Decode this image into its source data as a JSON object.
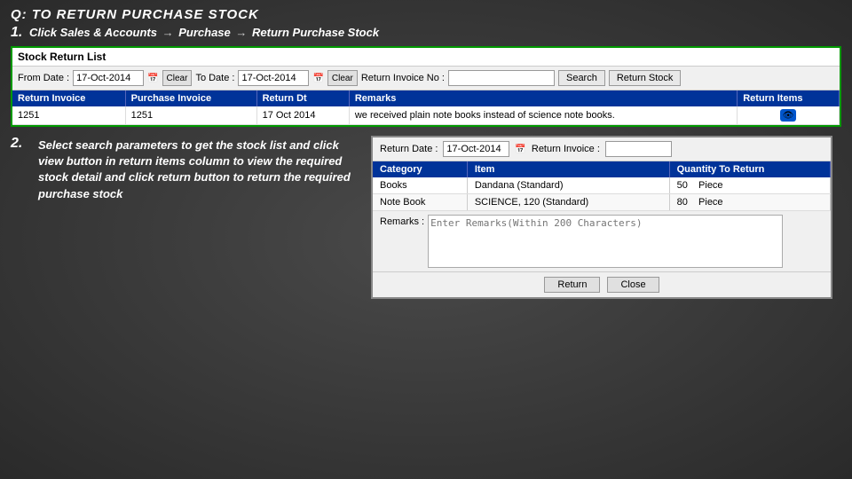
{
  "title": "Q: TO RETURN PURCHASE STOCK",
  "step1": {
    "num": "1.",
    "text": "Click Sales & Accounts",
    "arrow1": "→",
    "part2": "Purchase",
    "arrow2": "→",
    "part3": "Return Purchase Stock"
  },
  "panel": {
    "header": "Stock Return List",
    "filter": {
      "from_label": "From Date :",
      "from_value": "17-Oct-2014",
      "clear1": "Clear",
      "to_label": "To Date :",
      "to_value": "17-Oct-2014",
      "clear2": "Clear",
      "invoice_label": "Return Invoice No :",
      "invoice_value": "",
      "search_btn": "Search",
      "return_stock_btn": "Return Stock"
    },
    "table": {
      "headers": [
        "Return Invoice",
        "Purchase Invoice",
        "Return Dt",
        "Remarks",
        "Return Items"
      ],
      "rows": [
        {
          "return_invoice": "1251",
          "purchase_invoice": "1251",
          "return_dt": "17 Oct 2014",
          "remarks": "we received plain note books instead of science note books.",
          "has_view": true
        }
      ]
    }
  },
  "step2": {
    "num": "2.",
    "text": "Select search parameters to get the stock list and click view button in return items column to view the required stock detail and click return button to return the required purchase stock"
  },
  "dialog": {
    "date_label": "Return Date :",
    "date_value": "17-Oct-2014",
    "invoice_label": "Return Invoice :",
    "invoice_value": "",
    "table": {
      "headers": [
        "Category",
        "Item",
        "Quantity To Return"
      ],
      "rows": [
        {
          "category": "Books",
          "item": "Dandana (Standard)",
          "qty": "50",
          "unit": "Piece"
        },
        {
          "category": "Note Book",
          "item": "SCIENCE, 120 (Standard)",
          "qty": "80",
          "unit": "Piece"
        }
      ]
    },
    "remarks_label": "Remarks :",
    "remarks_placeholder": "Enter Remarks(Within 200 Characters)",
    "return_btn": "Return",
    "close_btn": "Close"
  }
}
